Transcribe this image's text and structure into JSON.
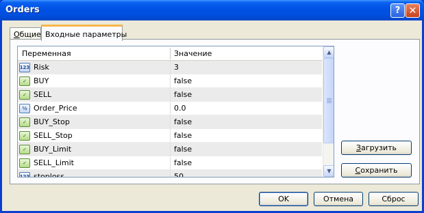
{
  "window": {
    "title": "Orders"
  },
  "titlebar": {
    "help_label": "?",
    "close_label": "✕"
  },
  "tabs": [
    {
      "label_u": "О",
      "label_rest": "бщие"
    },
    {
      "label": "Входные параметры"
    }
  ],
  "grid": {
    "col_variable": "Переменная",
    "col_value": "Значение",
    "rows": [
      {
        "icon": "123",
        "name": "Risk",
        "value": "3"
      },
      {
        "icon": "bool",
        "name": "BUY",
        "value": "false"
      },
      {
        "icon": "bool",
        "name": "SELL",
        "value": "false"
      },
      {
        "icon": "½",
        "name": "Order_Price",
        "value": "0.0"
      },
      {
        "icon": "bool",
        "name": "BUY_Stop",
        "value": "false"
      },
      {
        "icon": "bool",
        "name": "SELL_Stop",
        "value": "false"
      },
      {
        "icon": "bool",
        "name": "BUY_Limit",
        "value": "false"
      },
      {
        "icon": "bool",
        "name": "SELL_Limit",
        "value": "false"
      },
      {
        "icon": "123",
        "name": "stoploss",
        "value": "50"
      }
    ]
  },
  "buttons": {
    "load_u": "З",
    "load_rest": "агрузить",
    "save_u": "С",
    "save_rest": "охранить",
    "ok": "OK",
    "cancel": "Отмена",
    "reset": "Сброс"
  }
}
